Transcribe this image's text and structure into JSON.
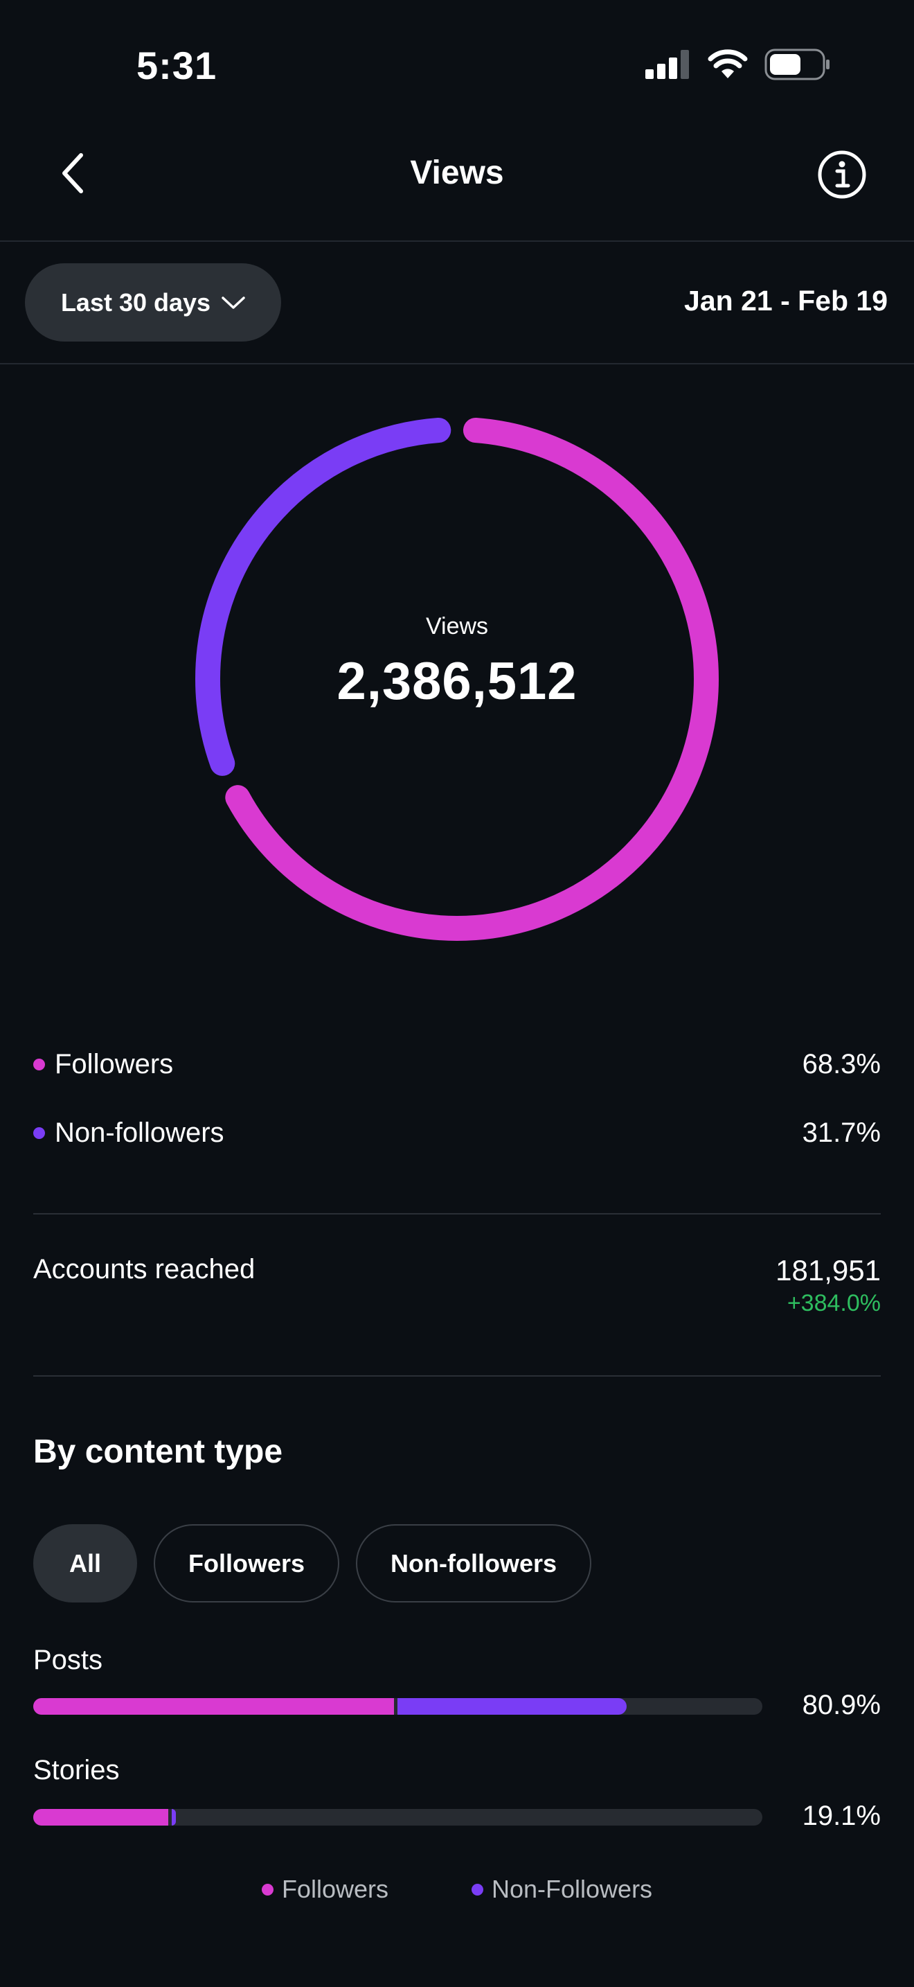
{
  "status_bar": {
    "time": "5:31"
  },
  "header": {
    "title": "Views"
  },
  "filter": {
    "range_label": "Last 30 days",
    "date_range": "Jan 21 - Feb 19"
  },
  "donut": {
    "label": "Views",
    "value": "2,386,512",
    "followers_fraction": 0.683,
    "non_followers_fraction": 0.317
  },
  "legend": [
    {
      "label": "Followers",
      "value": "68.3%",
      "color": "#d93ad1"
    },
    {
      "label": "Non-followers",
      "value": "31.7%",
      "color": "#7a3df5"
    }
  ],
  "accounts_reached": {
    "label": "Accounts reached",
    "value": "181,951",
    "change": "+384.0%"
  },
  "content_type": {
    "heading": "By content type",
    "tabs": [
      "All",
      "Followers",
      "Non-followers"
    ],
    "rows": [
      {
        "label": "Posts",
        "value": "80.9%",
        "followers_fraction": 0.495,
        "non_followers_fraction": 0.314
      },
      {
        "label": "Stories",
        "value": "19.1%",
        "followers_fraction": 0.185,
        "non_followers_fraction": 0.006
      }
    ],
    "legend": [
      "Followers",
      "Non-Followers"
    ]
  },
  "colors": {
    "followers": "#d93ad1",
    "non_followers": "#7a3df5",
    "positive": "#2ebd5f"
  },
  "icons": [
    "signal-icon",
    "wifi-icon",
    "battery-icon",
    "back-icon",
    "info-icon",
    "chevron-down-icon"
  ]
}
